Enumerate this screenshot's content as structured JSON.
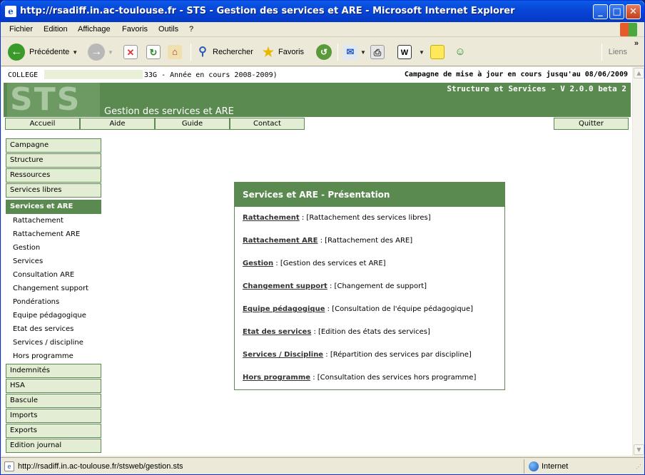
{
  "window": {
    "title": "http://rsadiff.in.ac-toulouse.fr - STS - Gestion des services et ARE - Microsoft Internet Explorer"
  },
  "menu": [
    "Fichier",
    "Edition",
    "Affichage",
    "Favoris",
    "Outils",
    "?"
  ],
  "toolbar": {
    "back": "Précédente",
    "search": "Rechercher",
    "favorites": "Favoris",
    "links": "Liens"
  },
  "page": {
    "college_label": "COLLEGE",
    "annee": "33G - Année en cours 2008-2009)",
    "campagne_text": "Campagne de mise à jour en cours jusqu'au",
    "campagne_date": "08/06/2009",
    "logo": "STS",
    "app_title": "Gestion des services et ARE",
    "version": "Structure et Services - V 2.0.0 beta 2",
    "nav": {
      "accueil": "Accueil",
      "aide": "Aide",
      "guide": "Guide",
      "contact": "Contact",
      "quitter": "Quitter"
    },
    "sidebar": {
      "top": [
        "Campagne",
        "Structure",
        "Ressources",
        "Services libres",
        "Services et ARE"
      ],
      "sub": [
        "Rattachement",
        "Rattachement ARE",
        "Gestion",
        "Services",
        "Consultation ARE",
        "Changement support",
        "Pondérations",
        "Equipe pédagogique",
        "Etat des services",
        "Services / discipline",
        "Hors programme"
      ],
      "bottom": [
        "Indemnités",
        "HSA",
        "Bascule",
        "Imports",
        "Exports",
        "Edition journal"
      ]
    },
    "panel": {
      "title": "Services et ARE - Présentation",
      "rows": [
        {
          "link": "Rattachement",
          "desc": " : [Rattachement des services libres]"
        },
        {
          "link": "Rattachement ARE",
          "desc": " : [Rattachement des ARE]"
        },
        {
          "link": "Gestion",
          "desc": " : [Gestion des services et ARE]"
        },
        {
          "link": "Changement support",
          "desc": " : [Changement de support]"
        },
        {
          "link": "Equipe pédagogique",
          "desc": " : [Consultation de l'équipe pédagogique]"
        },
        {
          "link": "Etat des services",
          "desc": " : [Edition des états des services]"
        },
        {
          "link": "Services / Discipline",
          "desc": " : [Répartition des services par discipline]"
        },
        {
          "link": "Hors programme",
          "desc": " : [Consultation des services hors programme]"
        }
      ]
    }
  },
  "status": {
    "url": "http://rsadiff.in.ac-toulouse.fr/stsweb/gestion.sts",
    "zone": "Internet"
  }
}
